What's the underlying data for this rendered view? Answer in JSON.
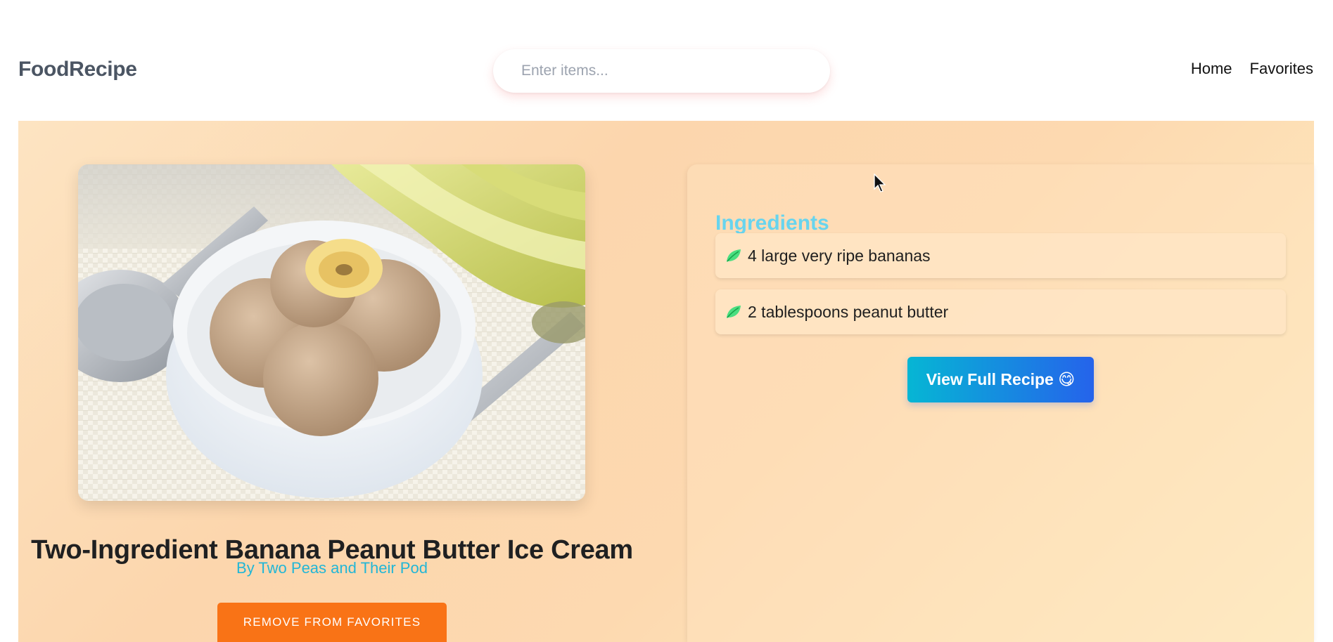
{
  "navbar": {
    "brand": "FoodRecipe",
    "search_placeholder": "Enter items...",
    "links": [
      "Home",
      "Favorites"
    ]
  },
  "recipe": {
    "title": "Two-Ingredient Banana Peanut Butter Ice Cream",
    "author": "By Two Peas and Their Pod",
    "remove_label": "REMOVE FROM FAVORITES",
    "image_alt": "bowl of banana peanut butter ice cream"
  },
  "ingredients": {
    "heading": "Ingredients",
    "items": [
      "4 large very ripe bananas",
      "2 tablespoons peanut butter"
    ],
    "view_label": "View Full Recipe 😋"
  },
  "colors": {
    "brand": "#4b5563",
    "accent_orange": "#f97316",
    "heading_cyan": "#67d4ee",
    "author_cyan": "#22b6d6",
    "button_gradient_start": "#06b6d4",
    "button_gradient_end": "#2563eb",
    "leaf_green": "#4ade80"
  },
  "icons": {
    "ingredient": "leaf-icon",
    "pointer": "cursor-icon"
  }
}
